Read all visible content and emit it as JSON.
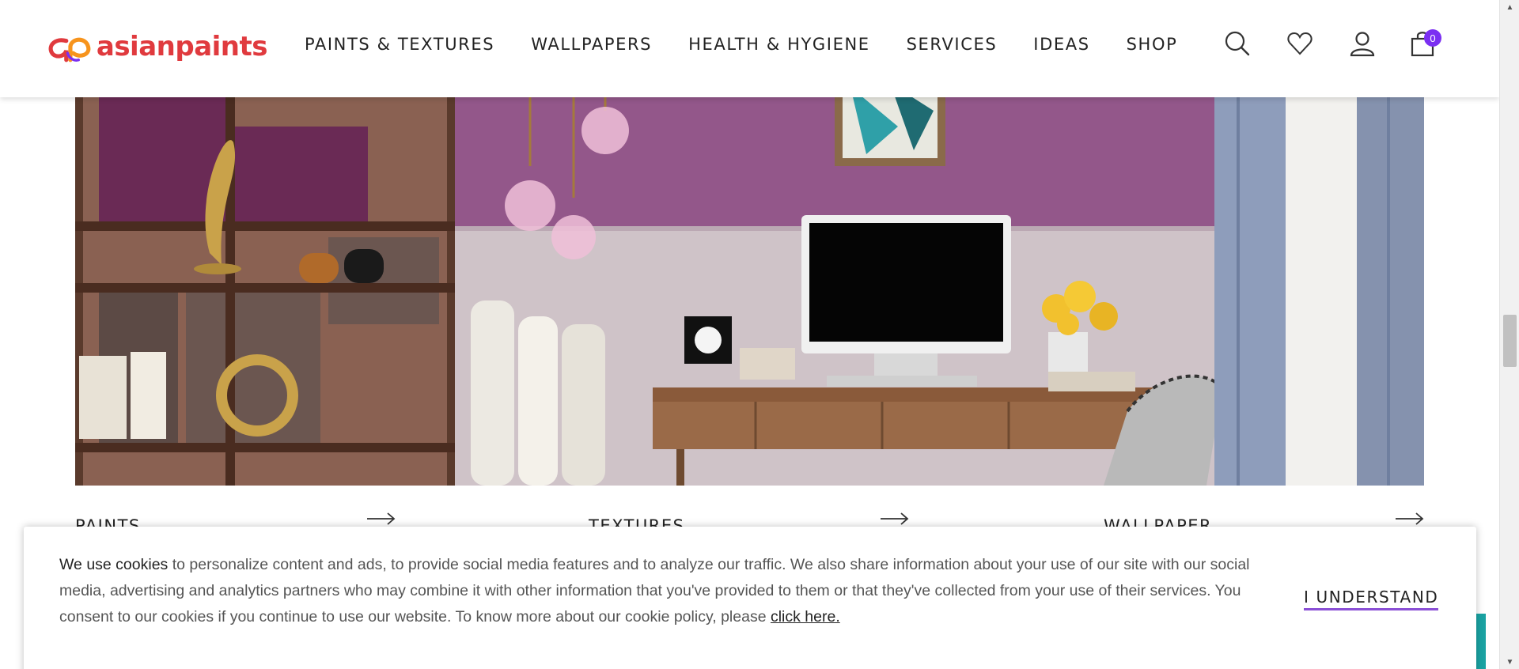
{
  "brand": {
    "name": "asianpaints",
    "colors": {
      "primary": "#e03a3e",
      "accent_orange": "#f7941d",
      "accent_purple": "#7b2ff2",
      "underline": "#8a4fd6"
    }
  },
  "nav": {
    "items": [
      {
        "label": "PAINTS & TEXTURES"
      },
      {
        "label": "WALLPAPERS"
      },
      {
        "label": "HEALTH & HYGIENE"
      },
      {
        "label": "SERVICES"
      },
      {
        "label": "IDEAS"
      },
      {
        "label": "SHOP"
      }
    ]
  },
  "header_icons": [
    "search-icon",
    "wishlist-heart-icon",
    "account-icon",
    "cart-bag-icon"
  ],
  "cart": {
    "count": "0"
  },
  "categories": [
    {
      "label": "PAINTS",
      "icon": "arrow-right-icon"
    },
    {
      "label": "TEXTURES",
      "icon": "arrow-right-icon"
    },
    {
      "label": "WALLPAPER",
      "icon": "arrow-right-icon"
    }
  ],
  "cookie": {
    "lead": "We use cookies",
    "body": " to personalize content and ads, to provide social media features and to analyze our traffic. We also share information about your use of our site with our social media, advertising and analytics partners who may combine it with other information that you've provided to them or that they've collected from your use of their services. You consent to our cookies if you continue to use our website. To know more about our cookie policy, please ",
    "link": "click here.",
    "button": "I UNDERSTAND"
  }
}
